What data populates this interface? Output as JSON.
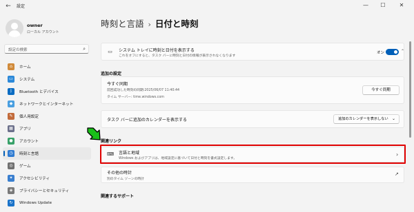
{
  "window": {
    "title": "設定",
    "back_icon": "back-arrow-icon",
    "minimize": "—",
    "maximize": "☐",
    "close": "✕"
  },
  "profile": {
    "name": "owner",
    "account_type": "ローカル アカウント"
  },
  "search": {
    "placeholder": "設定の検索"
  },
  "sidebar": {
    "items": [
      {
        "label": "ホーム",
        "icon": "home-icon",
        "color": "#d08a3a"
      },
      {
        "label": "システム",
        "icon": "system-icon",
        "color": "#2b88d8"
      },
      {
        "label": "Bluetooth とデバイス",
        "icon": "bluetooth-icon",
        "color": "#0a6cc2"
      },
      {
        "label": "ネットワークとインターネット",
        "icon": "network-icon",
        "color": "#4a9fe0"
      },
      {
        "label": "個人用設定",
        "icon": "personalization-icon",
        "color": "#c26b3b"
      },
      {
        "label": "アプリ",
        "icon": "apps-icon",
        "color": "#6b6f8a"
      },
      {
        "label": "アカウント",
        "icon": "accounts-icon",
        "color": "#38a169"
      },
      {
        "label": "時刻と言語",
        "icon": "time-language-icon",
        "color": "#2f7bd1",
        "active": true
      },
      {
        "label": "ゲーム",
        "icon": "gaming-icon",
        "color": "#707070"
      },
      {
        "label": "アクセシビリティ",
        "icon": "accessibility-icon",
        "color": "#3a7fcf"
      },
      {
        "label": "プライバシーとセキュリティ",
        "icon": "privacy-icon",
        "color": "#7a7a7a"
      },
      {
        "label": "Windows Update",
        "icon": "windows-update-icon",
        "color": "#1a73c9"
      }
    ]
  },
  "main": {
    "breadcrumb_parent": "時刻と言語",
    "breadcrumb_sep": "›",
    "breadcrumb_current": "日付と時刻",
    "tray_card": {
      "title": "システム トレイに時刻と日付を表示する",
      "subtitle": "これをオフにすると、タスク バーに時刻と日付の情報が表示されなくなります",
      "toggle_label": "オン",
      "toggle_on": true
    },
    "additional_section": "追加の設定",
    "sync_card": {
      "title": "今すぐ同期",
      "last_sync": "前回成功した時刻の同期:2025/06/07 11:40:44",
      "time_server": "タイム サーバー: time.windows.com",
      "button": "今すぐ同期"
    },
    "calendar_card": {
      "title": "タスク バーに追加のカレンダーを表示する",
      "dropdown": "追加のカレンダーを表示しない"
    },
    "related_section": "関連リンク",
    "region_card": {
      "title": "言語と地域",
      "subtitle": "Windows およびアプリは、地域設定に基づいて日付と時刻を書式設定します。"
    },
    "other_clocks_card": {
      "title": "その他の時計",
      "subtitle": "別のタイム ゾーンの時計"
    },
    "support_section": "関連するサポート"
  },
  "colors": {
    "accent": "#005fb8",
    "highlight": "#e00000",
    "arrow": "#19c019"
  }
}
